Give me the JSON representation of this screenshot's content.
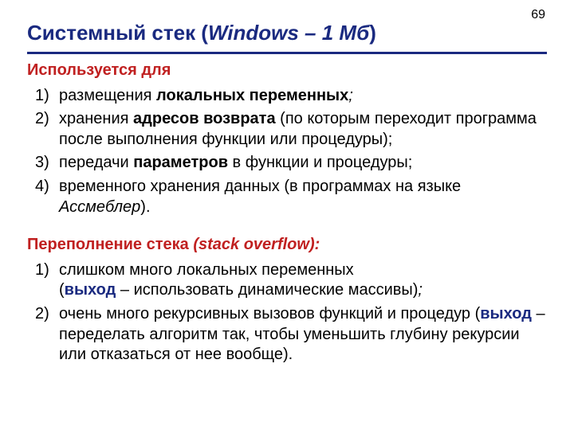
{
  "page_number": "69",
  "title": {
    "prefix": "Системный стек (",
    "italic": "Windows – 1 Мб",
    "suffix": ")"
  },
  "section1": {
    "heading": "Используется для",
    "items": [
      {
        "num": "1)",
        "parts": [
          {
            "t": "размещения ",
            "cls": ""
          },
          {
            "t": "локальных переменных",
            "cls": "b"
          },
          {
            "t": ";",
            "cls": "i"
          }
        ]
      },
      {
        "num": "2)",
        "parts": [
          {
            "t": "хранения ",
            "cls": ""
          },
          {
            "t": "адресов возврата",
            "cls": "b"
          },
          {
            "t": " (по которым переходит программа после выполнения функции или процедуры);",
            "cls": ""
          }
        ]
      },
      {
        "num": "3)",
        "parts": [
          {
            "t": "передачи ",
            "cls": ""
          },
          {
            "t": "параметров",
            "cls": "b"
          },
          {
            "t": " в функции и процедуры;",
            "cls": ""
          }
        ]
      },
      {
        "num": "4)",
        "parts": [
          {
            "t": "временного хранения данных (в программах на языке ",
            "cls": ""
          },
          {
            "t": "Ассмеблер",
            "cls": "i"
          },
          {
            "t": ").",
            "cls": ""
          }
        ]
      }
    ]
  },
  "section2": {
    "heading_plain": "Переполнение стека ",
    "heading_italic": "(stack overflow):",
    "items": [
      {
        "num": "1)",
        "parts": [
          {
            "t": "слишком много локальных переменных",
            "cls": ""
          },
          {
            "t": "\n(",
            "cls": ""
          },
          {
            "t": "выход",
            "cls": "exit"
          },
          {
            "t": " – использовать динамические массивы)",
            "cls": ""
          },
          {
            "t": ";",
            "cls": "i"
          }
        ]
      },
      {
        "num": "2)",
        "parts": [
          {
            "t": "очень много рекурсивных вызовов функций и процедур (",
            "cls": ""
          },
          {
            "t": "выход",
            "cls": "exit"
          },
          {
            "t": " – переделать алгоритм так, чтобы уменьшить глубину рекурсии или отказаться от нее вообще).",
            "cls": ""
          }
        ]
      }
    ]
  }
}
